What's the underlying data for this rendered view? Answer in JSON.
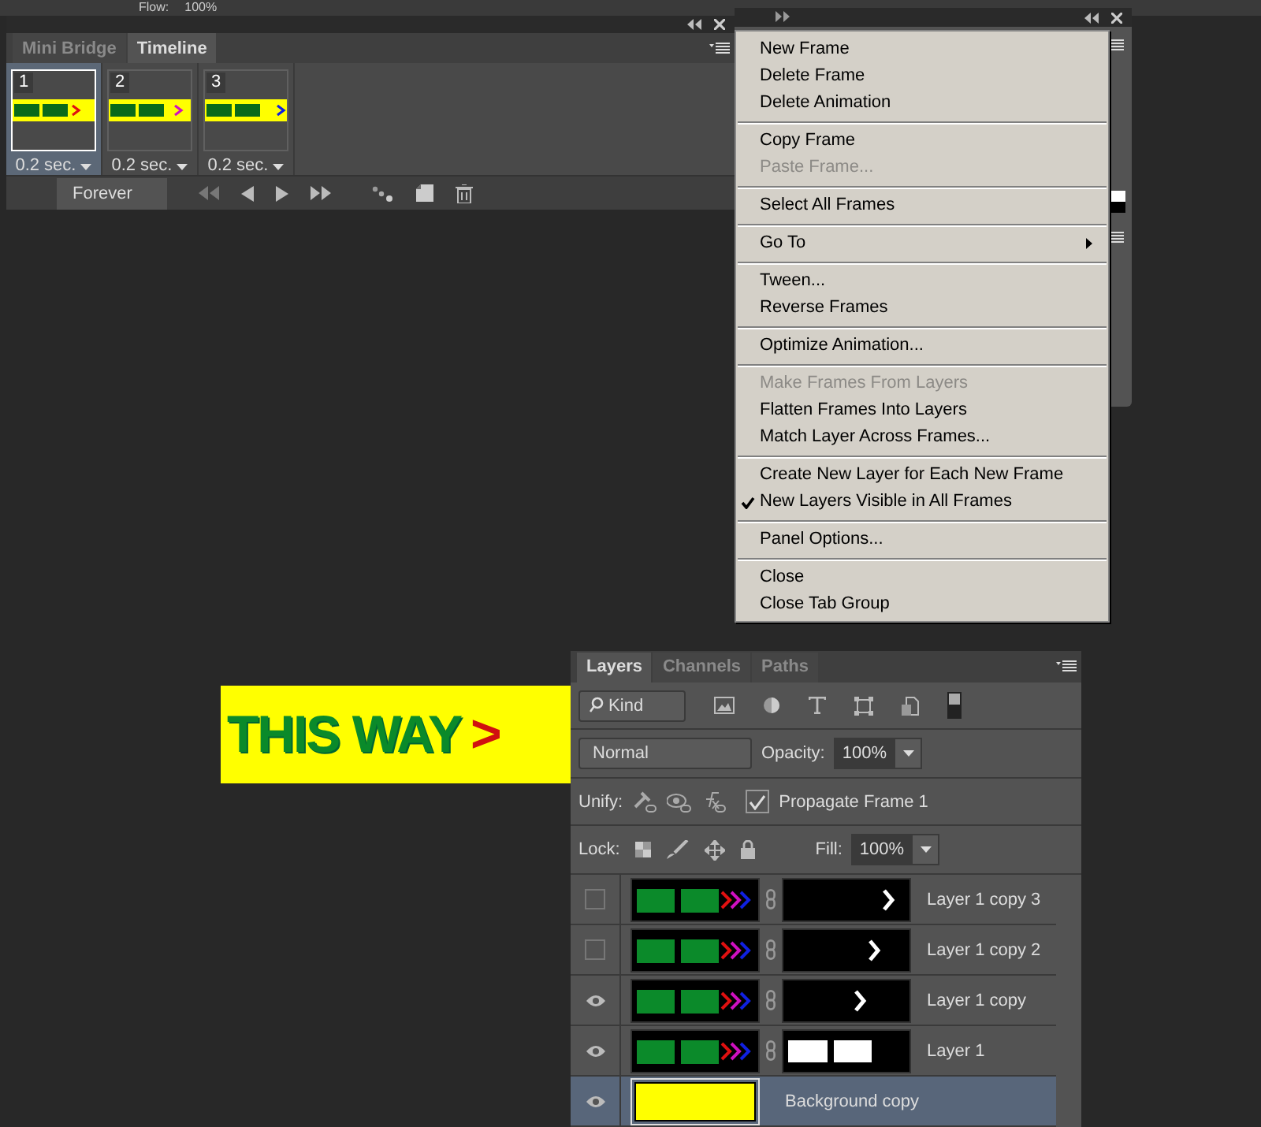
{
  "options_bar": {
    "flow_label": "Flow:",
    "flow_value": "100%"
  },
  "timeline_panel": {
    "tabs": [
      {
        "label": "Mini Bridge",
        "selected": false
      },
      {
        "label": "Timeline",
        "selected": true
      }
    ],
    "frames": [
      {
        "number": "1",
        "delay": "0.2 sec.",
        "selected": true,
        "color": "#e01010"
      },
      {
        "number": "2",
        "delay": "0.2 sec.",
        "selected": false,
        "color": "#d010c0"
      },
      {
        "number": "3",
        "delay": "0.2 sec.",
        "selected": false,
        "color": "#1020e0"
      }
    ],
    "loop": "Forever"
  },
  "menu": {
    "groups": [
      [
        {
          "label": "New Frame",
          "disabled": false,
          "checked": false,
          "submenu": false
        },
        {
          "label": "Delete Frame",
          "disabled": false,
          "checked": false,
          "submenu": false
        },
        {
          "label": "Delete Animation",
          "disabled": false,
          "checked": false,
          "submenu": false
        }
      ],
      [
        {
          "label": "Copy Frame",
          "disabled": false,
          "checked": false,
          "submenu": false
        },
        {
          "label": "Paste Frame...",
          "disabled": true,
          "checked": false,
          "submenu": false
        }
      ],
      [
        {
          "label": "Select All Frames",
          "disabled": false,
          "checked": false,
          "submenu": false
        }
      ],
      [
        {
          "label": "Go To",
          "disabled": false,
          "checked": false,
          "submenu": true
        }
      ],
      [
        {
          "label": "Tween...",
          "disabled": false,
          "checked": false,
          "submenu": false
        },
        {
          "label": "Reverse Frames",
          "disabled": false,
          "checked": false,
          "submenu": false
        }
      ],
      [
        {
          "label": "Optimize Animation...",
          "disabled": false,
          "checked": false,
          "submenu": false
        }
      ],
      [
        {
          "label": "Make Frames From Layers",
          "disabled": true,
          "checked": false,
          "submenu": false
        },
        {
          "label": "Flatten Frames Into Layers",
          "disabled": false,
          "checked": false,
          "submenu": false
        },
        {
          "label": "Match Layer Across Frames...",
          "disabled": false,
          "checked": false,
          "submenu": false
        }
      ],
      [
        {
          "label": "Create New Layer for Each New Frame",
          "disabled": false,
          "checked": false,
          "submenu": false
        },
        {
          "label": "New Layers Visible in All Frames",
          "disabled": false,
          "checked": true,
          "submenu": false
        }
      ],
      [
        {
          "label": "Panel Options...",
          "disabled": false,
          "checked": false,
          "submenu": false
        }
      ],
      [
        {
          "label": "Close",
          "disabled": false,
          "checked": false,
          "submenu": false
        },
        {
          "label": "Close Tab Group",
          "disabled": false,
          "checked": false,
          "submenu": false
        }
      ]
    ]
  },
  "canvas": {
    "text": "THIS WAY",
    "arrow": ">"
  },
  "layers_panel": {
    "tabs": [
      {
        "label": "Layers",
        "selected": true
      },
      {
        "label": "Channels",
        "selected": false
      },
      {
        "label": "Paths",
        "selected": false
      }
    ],
    "filter": "Kind",
    "blend_mode": "Normal",
    "opacity_label": "Opacity:",
    "opacity": "100%",
    "unify_label": "Unify:",
    "propagate": {
      "label": "Propagate Frame 1",
      "checked": true
    },
    "lock_label": "Lock:",
    "fill_label": "Fill:",
    "fill": "100%",
    "layers": [
      {
        "name": "Layer 1 copy 3",
        "visible": false,
        "selected": false,
        "kind": "arrow_mask"
      },
      {
        "name": "Layer 1 copy 2",
        "visible": false,
        "selected": false,
        "kind": "arrow_mask"
      },
      {
        "name": "Layer 1 copy",
        "visible": true,
        "selected": false,
        "kind": "arrow_mask"
      },
      {
        "name": "Layer 1",
        "visible": true,
        "selected": false,
        "kind": "text_mask"
      },
      {
        "name": "Background copy",
        "visible": true,
        "selected": true,
        "kind": "fill"
      }
    ]
  }
}
